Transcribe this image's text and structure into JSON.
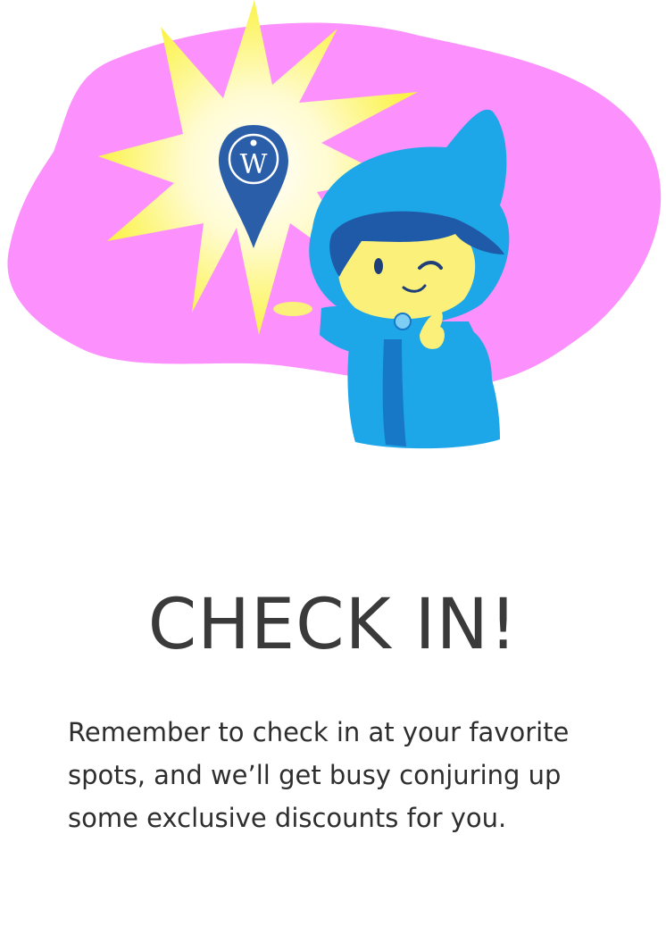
{
  "onboarding": {
    "title": "CHECK IN!",
    "description": "Remember to check in at your favorite spots, and we’ll get busy conjuring up some exclusive discounts for you."
  },
  "illustration": {
    "logo_letter": "W",
    "colors": {
      "background_blob": "#fc90fc",
      "burst": "#fbf34a",
      "pin": "#2a5ea8",
      "hood": "#1da6e8",
      "face": "#fbf07a",
      "hair": "#1f5aa8"
    }
  }
}
